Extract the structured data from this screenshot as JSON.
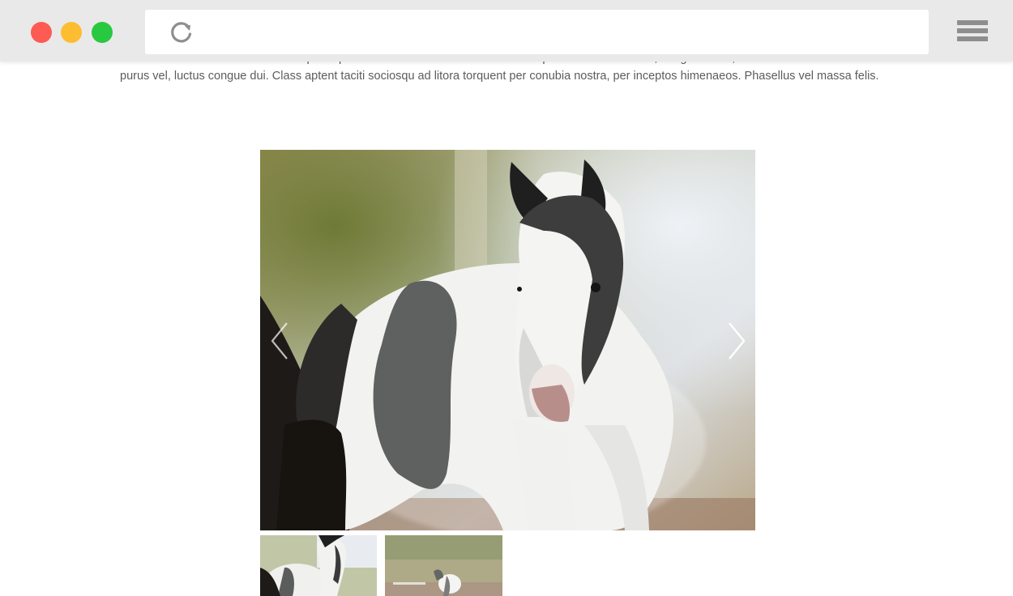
{
  "browser": {
    "window_controls": [
      "close",
      "minimize",
      "maximize"
    ],
    "icons": {
      "reload": "reload-icon",
      "menu": "hamburger-menu-icon"
    },
    "colors": {
      "close": "#fd5b53",
      "minimize": "#fdbd30",
      "maximize": "#28c840",
      "toolbar": "#e9e9e9"
    }
  },
  "article": {
    "partial_line": "sem. Nulla facilisi. Vestibulum ante ipsum primis in faucibus orci luctus et ultrices posuere cubilia curae; Integer mattis,",
    "paragraph": "purus vel, luctus congue dui. Class aptent taciti sociosqu ad litora torquent per conubia nostra, per inceptos himenaeos. Phasellus vel massa felis."
  },
  "gallery": {
    "main_image": "black-and-white-foal-photo",
    "thumbnails": [
      "foal-closeup-thumbnail",
      "foal-in-paddock-thumbnail"
    ],
    "icons": {
      "prev": "chevron-left-icon",
      "next": "chevron-right-icon"
    }
  }
}
